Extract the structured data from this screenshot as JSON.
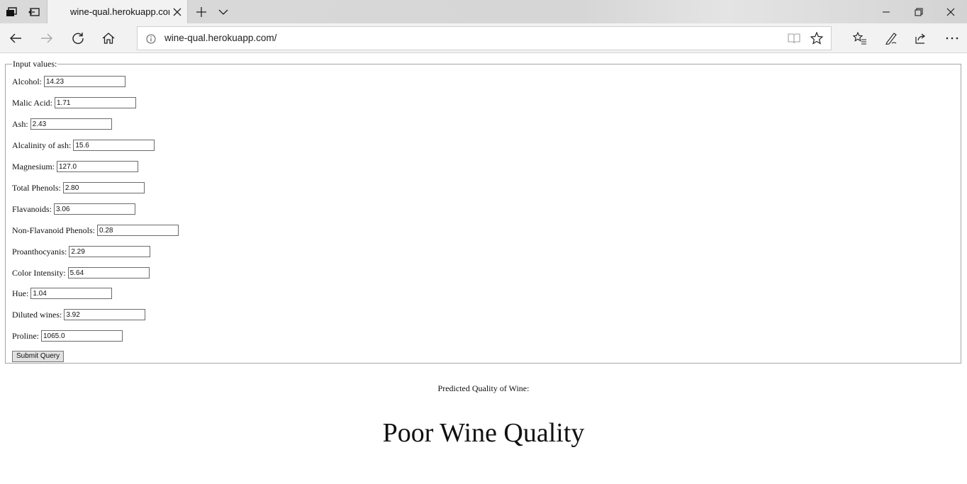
{
  "browser": {
    "tab_title": "wine-qual.herokuapp.com",
    "url": "wine-qual.herokuapp.com/"
  },
  "icons": {
    "tab_manager": "tab-manager-icon",
    "set_tabs_aside": "set-tabs-aside-icon",
    "close": "close-icon",
    "new_tab": "plus-icon",
    "tab_preview": "chevron-down-icon",
    "minimize": "minimize-icon",
    "restore": "restore-icon",
    "back": "back-arrow-icon",
    "forward": "forward-arrow-icon",
    "refresh": "refresh-icon",
    "home": "home-icon",
    "site_info": "info-icon",
    "reading_view": "book-icon",
    "favorite": "star-icon",
    "favorites_list": "favorites-icon",
    "notes": "pen-icon",
    "share": "share-icon",
    "more": "more-icon"
  },
  "form": {
    "legend": "Input values:",
    "fields": [
      {
        "label": "Alcohol:",
        "value": "14.23"
      },
      {
        "label": "Malic Acid:",
        "value": "1.71"
      },
      {
        "label": "Ash:",
        "value": "2.43"
      },
      {
        "label": "Alcalinity of ash:",
        "value": "15.6"
      },
      {
        "label": "Magnesium:",
        "value": "127.0"
      },
      {
        "label": "Total Phenols:",
        "value": "2.80"
      },
      {
        "label": "Flavanoids:",
        "value": "3.06"
      },
      {
        "label": "Non-Flavanoid Phenols:",
        "value": "0.28"
      },
      {
        "label": "Proanthocyanis:",
        "value": "2.29"
      },
      {
        "label": "Color Intensity:",
        "value": "5.64"
      },
      {
        "label": "Hue:",
        "value": "1.04"
      },
      {
        "label": "Diluted wines:",
        "value": "3.92"
      },
      {
        "label": "Proline:",
        "value": "1065.0"
      }
    ],
    "submit_label": "Submit Query"
  },
  "result": {
    "label": "Predicted Quality of Wine:",
    "value": "Poor Wine Quality"
  }
}
